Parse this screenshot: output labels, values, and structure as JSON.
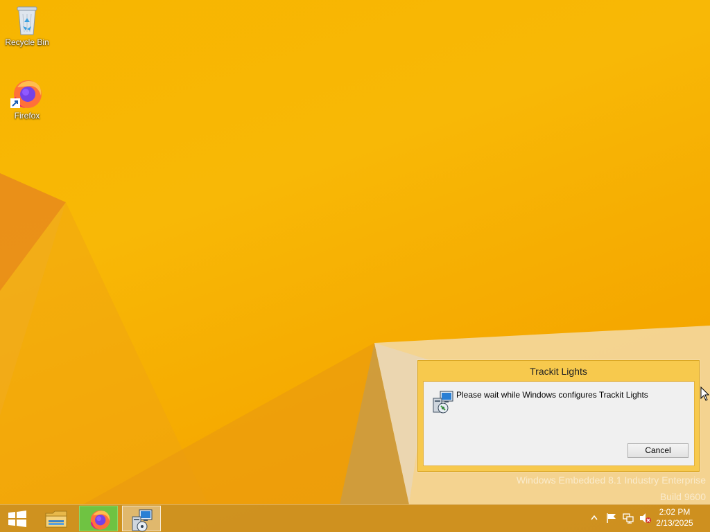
{
  "desktop": {
    "icons": [
      {
        "label": "Recycle Bin",
        "icon": "recycle-bin-icon"
      },
      {
        "label": "Firefox",
        "icon": "firefox-icon"
      }
    ],
    "watermark": {
      "line1": "Windows Embedded 8.1 Industry Enterprise",
      "line2": "Build 9600"
    }
  },
  "dialog": {
    "title": "Trackit Lights",
    "message": "Please wait while Windows configures Trackit Lights",
    "icon": "installer-icon",
    "cancel_label": "Cancel"
  },
  "taskbar": {
    "buttons": [
      {
        "icon": "start-icon"
      },
      {
        "icon": "file-explorer-icon"
      },
      {
        "icon": "firefox-icon",
        "active": true
      },
      {
        "icon": "installer-icon",
        "active": true
      }
    ],
    "tray": {
      "icons": [
        "show-hidden-icons-chevron",
        "action-center-flag-icon",
        "network-icon",
        "volume-muted-icon"
      ],
      "time": "2:02 PM",
      "date": "2/13/2025"
    }
  },
  "colors": {
    "wallpaper": "#f7b500",
    "dialog_frame": "#f7c94d",
    "dialog_client": "#f0f0f0",
    "taskbar": "#c48c28",
    "firefox_button": "#6fc342"
  }
}
